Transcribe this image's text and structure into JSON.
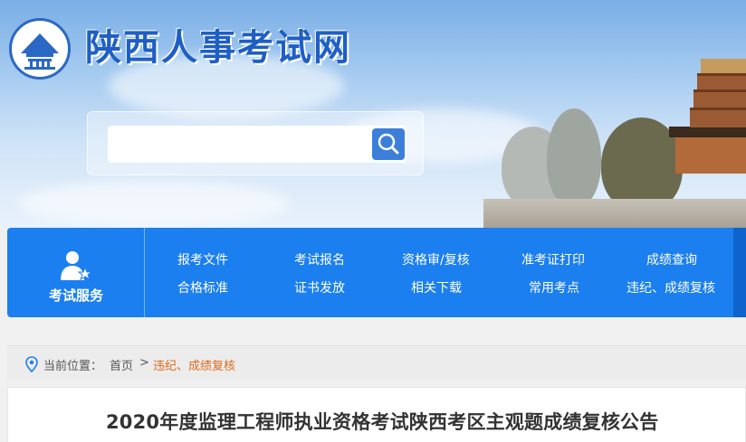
{
  "site": {
    "title": "陕西人事考试网"
  },
  "search": {
    "placeholder": "",
    "value": ""
  },
  "nav": {
    "section_label": "考试服务",
    "links": [
      "报考文件",
      "考试报名",
      "资格审/复核",
      "准考证打印",
      "成绩查询",
      "合格标准",
      "证书发放",
      "相关下载",
      "常用考点",
      "违纪、成绩复核"
    ]
  },
  "breadcrumb": {
    "prefix": "当前位置：",
    "home": "首页",
    "separator": ">",
    "current": "违纪、成绩复核"
  },
  "article": {
    "title": "2020年度监理工程师执业资格考试陕西考区主观题成绩复核公告"
  },
  "colors": {
    "brand_blue": "#1b7ff0",
    "title_blue": "#1f5fc4",
    "breadcrumb_current": "#e06a1c"
  },
  "icons": {
    "logo": "wild-goose-pagoda-logo",
    "search": "magnifier-icon",
    "service": "person-star-icon",
    "location": "map-pin-icon"
  }
}
